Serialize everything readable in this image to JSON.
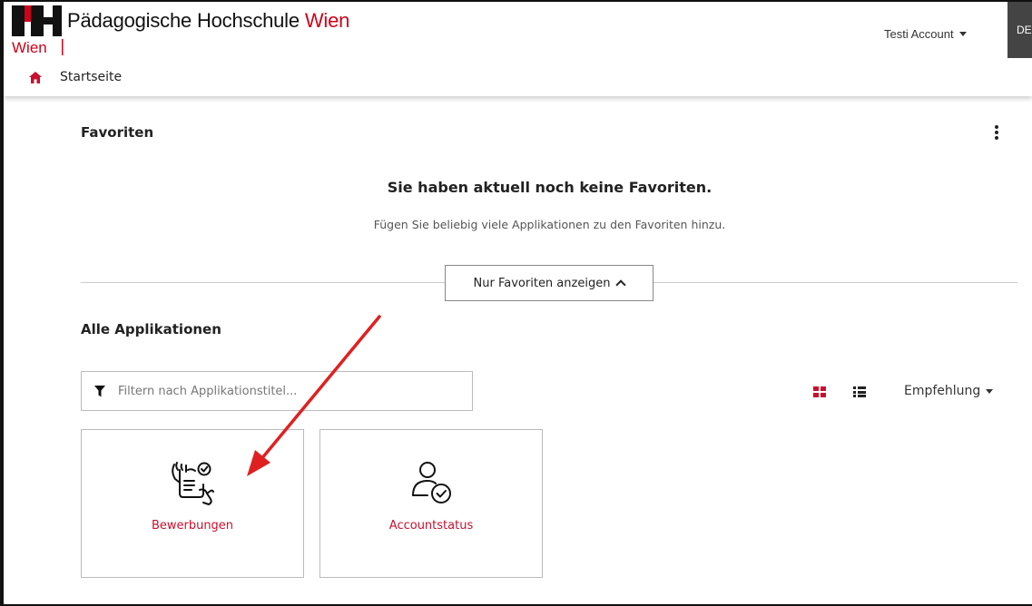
{
  "header": {
    "logo_text": "Wien",
    "brand_main": "Pädagogische Hochschule ",
    "brand_accent": "Wien",
    "user_name": "Testi Account",
    "lang_label": "DE"
  },
  "breadcrumb": {
    "label": "Startseite"
  },
  "favorites": {
    "title": "Favoriten",
    "empty_title": "Sie haben aktuell noch keine Favoriten.",
    "empty_sub": "Fügen Sie beliebig viele Applikationen zu den Favoriten hinzu.",
    "toggle_label": "Nur Favoriten anzeigen"
  },
  "apps": {
    "title": "Alle Applikationen",
    "filter_placeholder": "Filtern nach Applikationstitel...",
    "sort_label": "Empfehlung",
    "items": [
      {
        "label": "Bewerbungen",
        "icon": "application-hands-icon"
      },
      {
        "label": "Accountstatus",
        "icon": "user-check-icon"
      }
    ]
  },
  "colors": {
    "accent": "#c8102e",
    "brand_red": "#d0021b"
  }
}
